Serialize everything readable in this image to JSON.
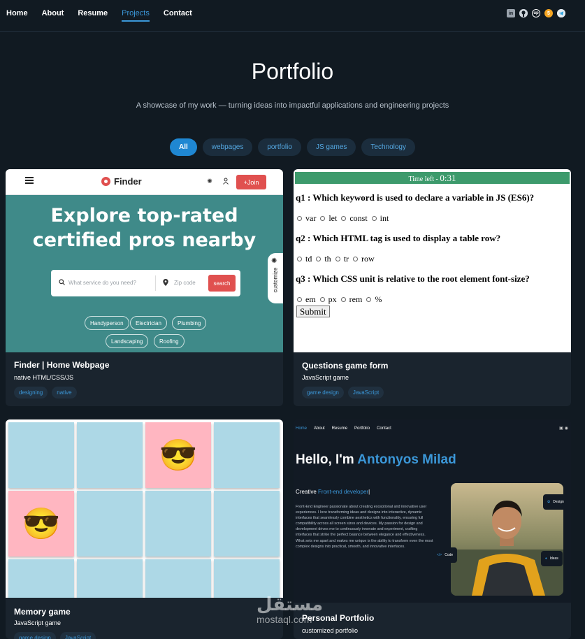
{
  "nav": {
    "links": [
      "Home",
      "About",
      "Resume",
      "Projects",
      "Contact"
    ],
    "active": "Projects",
    "socials": [
      "linkedin-icon",
      "github-icon",
      "upwork-icon",
      "fiverr-icon",
      "telegram-icon"
    ],
    "social_glyphs": {
      "linkedin": "in",
      "github": "",
      "upwork": "up",
      "fiverr": "5",
      "telegram": ""
    }
  },
  "header": {
    "title": "Portfolio",
    "subtitle": "A showcase of my work — turning ideas into impactful applications and engineering projects"
  },
  "filters": [
    "All",
    "webpages",
    "portfolio",
    "JS games",
    "Technology"
  ],
  "projects": [
    {
      "title": "Finder | Home Webpage",
      "desc": "native HTML/CSS/JS",
      "tags": [
        "designing",
        "native"
      ],
      "thumb": {
        "brand": "Finder",
        "join": "+Join",
        "hero_line1": "Explore top-rated",
        "hero_line2": "certified pros nearby",
        "search_placeholder": "What service do you need?",
        "zip_placeholder": "Zip code",
        "search_button": "search",
        "chips": [
          "Handyperson",
          "Electrician",
          "Plumbing",
          "Landscaping",
          "Roofing"
        ],
        "customize": "customize"
      }
    },
    {
      "title": "Questions game form",
      "desc": "JavaScript game",
      "tags": [
        "game design",
        "JavaScript"
      ],
      "thumb": {
        "timer_label": "Time left - ",
        "timer_value": "0:31",
        "questions": [
          {
            "q": "q1 : Which keyword is used to declare a variable in JS (ES6)?",
            "options": [
              "var",
              "let",
              "const",
              "int"
            ]
          },
          {
            "q": "q2 : Which HTML tag is used to display a table row?",
            "options": [
              "td",
              "th",
              "tr",
              "row"
            ]
          },
          {
            "q": "q3 : Which CSS unit is relative to the root element font-size?",
            "options": [
              "em",
              "px",
              "rem",
              "%"
            ]
          }
        ],
        "submit": "Submit"
      }
    },
    {
      "title": "Memory game",
      "desc": "JavaScript game",
      "tags": [
        "game design",
        "JavaScript"
      ],
      "thumb": {
        "face": "😎",
        "colors": {
          "tile": "#add8e6",
          "flipped": "#ffb6c1"
        }
      }
    },
    {
      "title": "Personal Portfolio",
      "desc": "customized portfolio",
      "tags": [],
      "thumb": {
        "nav": [
          "Home",
          "About",
          "Resume",
          "Portfolio",
          "Contact"
        ],
        "hello": "Hello, I'm ",
        "name": "Antonyos Milad",
        "role_prefix": "Creative ",
        "role": "Front-end developer",
        "role_suffix": "|",
        "bio": "Front-End Engineer passionate about creating exceptional and innovative user experiences. I love transforming ideas and designs into interactive, dynamic interfaces that seamlessly combine aesthetics with functionality, ensuring full compatibility across all screen sizes and devices. My passion for design and development drives me to continuously innovate and experiment, crafting interfaces that strike the perfect balance between elegance and effectiveness. What sets me apart and makes me unique is the ability to transform even the most complex designs into practical, smooth, and innovative interfaces.",
        "badges": [
          "Design",
          "Code",
          "Ideas"
        ]
      }
    }
  ],
  "watermark": {
    "arabic": "مستقل",
    "latin": "mostaql.com"
  },
  "colors": {
    "accent": "#3b97d8",
    "background": "#111a22",
    "card": "#1a242e"
  }
}
